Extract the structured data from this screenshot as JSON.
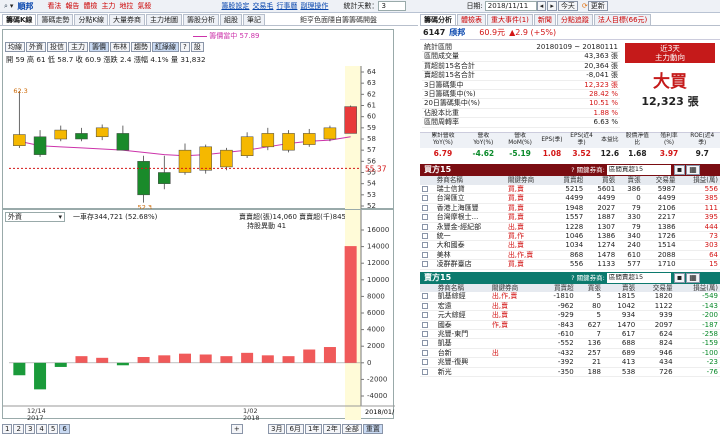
{
  "topbar": {
    "stock": "順邦",
    "links": [
      "看法",
      "報告",
      "體檢",
      "主力",
      "地拉",
      "氣殺"
    ],
    "right_links": [
      "籌股設定",
      "交易毛",
      "行事曆",
      "副理操作"
    ],
    "days_label": "統計天數：",
    "days_value": "3",
    "date_label": "日期:",
    "date_value": "2018/11/11",
    "today": "今天",
    "refresh": "更新"
  },
  "left": {
    "tabs": [
      "籌碼K線",
      "籌碼走勢",
      "分點K線",
      "大量券商",
      "主力地圖",
      "籌股分析",
      "組股",
      "筆記"
    ],
    "tab_active": 0,
    "tab_note": "鉅亨色面隱自籌籌碼開盤",
    "legend_line": "籌價當中 57.89",
    "tools": [
      "均線",
      "外資",
      "投信",
      "主力",
      "籌價",
      "布林",
      "趨勢",
      "紅綠線",
      "?",
      "設"
    ],
    "tools_on": [
      4,
      7
    ],
    "quote": "開 59 高 61 低 58.7 收 60.9 漲跌 2.4 漲幅 4.1% 量 31,832",
    "price_axis": [
      "64",
      "63",
      "62",
      "61",
      "60",
      "59",
      "58",
      "57",
      "56",
      "55",
      "54",
      "53",
      "52"
    ],
    "price_marker": "55.37",
    "max_label": "62.3",
    "min_label": "52.3",
    "sub_select": "外資",
    "sub_info": "一車存344,721 (52.68%)",
    "sub_info2": "賣賣超(張)14,060 賣賣超(千)845,478",
    "sub_info3": "持股異動 41",
    "vol_axis": [
      "16000",
      "14000",
      "12000",
      "10000",
      "8000",
      "6000",
      "4000",
      "2000",
      "0",
      "-2000",
      "-4000"
    ],
    "date_axis": [
      "12/14",
      "2017",
      "1/02",
      "2018"
    ],
    "date_cursor": "2018/01/11",
    "pages": [
      "1",
      "2",
      "3",
      "4",
      "5",
      "6"
    ],
    "ranges": [
      "3月",
      "6月",
      "1年",
      "2年",
      "全部",
      "重置"
    ]
  },
  "right": {
    "tabs": [
      "籌碼分析",
      "體檢表",
      "重大事件(1)",
      "新聞",
      "分點追蹤",
      "法人目標(66元)"
    ],
    "stock_code": "6147",
    "stock_name": "頎邦",
    "stock_price": "60.9元",
    "stock_change": "▲2.9 (+5%)",
    "stats": [
      {
        "label": "統計區間",
        "value": "20180109 ~ 20180111",
        "cls": ""
      },
      {
        "label": "區間成交量",
        "value": "43,363 張",
        "cls": ""
      },
      {
        "label": "買超前15名合計",
        "value": "20,364 張",
        "cls": ""
      },
      {
        "label": "賣超前15名合計",
        "value": "-8,041 張",
        "cls": ""
      },
      {
        "label": "3日籌碼集中",
        "value": "12,323 張",
        "cls": "rd"
      },
      {
        "label": "3日籌碼集中(%)",
        "value": "28.42 %",
        "cls": "rd"
      },
      {
        "label": "20日籌碼集中(%)",
        "value": "10.51 %",
        "cls": "rd"
      },
      {
        "label": "佔股本比重",
        "value": "1.88 %",
        "cls": "rd"
      },
      {
        "label": "區間周轉率",
        "value": "6.63 %",
        "cls": ""
      }
    ],
    "box_title": "近3天\n主力動向",
    "box_big": "大買",
    "box_value": "12,323 張",
    "fin_headers": [
      "累計營收YoY(%)",
      "營收YoY(%)",
      "營收MoM(%)",
      "EPS(季)",
      "EPS(近4季)",
      "本益比",
      "股價淨值比",
      "殖利率(%)",
      "ROE(近4季)"
    ],
    "fin_values": [
      "6.79",
      "-4.62",
      "-5.19",
      "1.08",
      "3.52",
      "12.6",
      "1.68",
      "3.97",
      "9.7"
    ],
    "fin_cls": [
      "rd",
      "gn",
      "gn",
      "rd",
      "rd",
      "",
      "",
      "rd",
      ""
    ],
    "buy_title": "買方15",
    "buy_filter_label": "? 關鍵券商:",
    "buy_filter": "區間買超15",
    "sell_title": "賣方15",
    "sell_filter_label": "? 關鍵券商:",
    "sell_filter": "區間賣超15",
    "table_headers": [
      "券商名稱",
      "關鍵券商",
      "買賣超",
      "買張",
      "賣張",
      "交易量",
      "損益(萬)"
    ],
    "buy_rows": [
      [
        "瑞士信貸",
        "買,賣",
        "5215",
        "5601",
        "386",
        "5987",
        "556"
      ],
      [
        "台灣匯立",
        "買,賣",
        "4499",
        "4499",
        "0",
        "4499",
        "385"
      ],
      [
        "香港上海匯豐",
        "買,賣",
        "1948",
        "2027",
        "79",
        "2106",
        "111"
      ],
      [
        "台灣摩根士...",
        "買,賣",
        "1557",
        "1887",
        "330",
        "2217",
        "395"
      ],
      [
        "永豐金-經紀部",
        "出,賣",
        "1228",
        "1307",
        "79",
        "1386",
        "444"
      ],
      [
        "統一",
        "買,作",
        "1046",
        "1386",
        "340",
        "1726",
        "73"
      ],
      [
        "大和國泰",
        "出,賣",
        "1034",
        "1274",
        "240",
        "1514",
        "303"
      ],
      [
        "美林",
        "出,作,賣",
        "868",
        "1478",
        "610",
        "2088",
        "64"
      ],
      [
        "凌群群臺店",
        "買,賣",
        "556",
        "1133",
        "577",
        "1710",
        "15"
      ]
    ],
    "sell_rows": [
      [
        "凱基綜經",
        "出,作,賣",
        "-1810",
        "5",
        "1815",
        "1820",
        "-549"
      ],
      [
        "宏遠",
        "出,賣",
        "-962",
        "80",
        "1042",
        "1122",
        "-143"
      ],
      [
        "元大綜經",
        "出,賣",
        "-929",
        "5",
        "934",
        "939",
        "-200"
      ],
      [
        "國泰",
        "作,賣",
        "-843",
        "627",
        "1470",
        "2097",
        "-187"
      ],
      [
        "兆豐-東門",
        "",
        "-610",
        "7",
        "617",
        "624",
        "-258"
      ],
      [
        "凱基",
        "",
        "-552",
        "136",
        "688",
        "824",
        "-159"
      ],
      [
        "台新",
        "出",
        "-432",
        "257",
        "689",
        "946",
        "-100"
      ],
      [
        "兆豐-復興",
        "",
        "-392",
        "21",
        "413",
        "434",
        "-23"
      ],
      [
        "新光",
        "",
        "-350",
        "188",
        "538",
        "726",
        "-76"
      ]
    ]
  },
  "chart_data": [
    {
      "type": "candlestick",
      "title": "",
      "ylim": [
        52,
        64
      ],
      "yticks": [
        52,
        53,
        54,
        55,
        56,
        57,
        58,
        59,
        60,
        61,
        62,
        63,
        64
      ],
      "candles": [
        {
          "o": 57.4,
          "c": 58.4,
          "h": 62.3,
          "l": 57.2
        },
        {
          "o": 58.2,
          "c": 56.6,
          "h": 58.8,
          "l": 56.4
        },
        {
          "o": 58.0,
          "c": 58.8,
          "h": 59.2,
          "l": 57.8
        },
        {
          "o": 58.5,
          "c": 58.0,
          "h": 59.0,
          "l": 57.8
        },
        {
          "o": 58.2,
          "c": 59.0,
          "h": 59.3,
          "l": 57.9
        },
        {
          "o": 58.5,
          "c": 57.0,
          "h": 59.2,
          "l": 57.0
        },
        {
          "o": 56.0,
          "c": 53.0,
          "h": 56.5,
          "l": 52.3
        },
        {
          "o": 55.0,
          "c": 54.0,
          "h": 56.5,
          "l": 53.5
        },
        {
          "o": 55.0,
          "c": 57.0,
          "h": 57.6,
          "l": 54.8
        },
        {
          "o": 55.2,
          "c": 57.3,
          "h": 57.5,
          "l": 54.9
        },
        {
          "o": 55.5,
          "c": 57.0,
          "h": 57.2,
          "l": 55.2
        },
        {
          "o": 56.5,
          "c": 58.2,
          "h": 58.6,
          "l": 56.3
        },
        {
          "o": 57.3,
          "c": 58.5,
          "h": 59.0,
          "l": 57.0
        },
        {
          "o": 57.0,
          "c": 58.5,
          "h": 58.8,
          "l": 56.8
        },
        {
          "o": 57.5,
          "c": 58.5,
          "h": 58.9,
          "l": 57.3
        },
        {
          "o": 58.0,
          "c": 59.0,
          "h": 59.2,
          "l": 57.8
        },
        {
          "o": 58.5,
          "c": 60.9,
          "h": 61.0,
          "l": 58.5
        }
      ],
      "ma": [
        57.8,
        57.4,
        57.3,
        57.2,
        57.1,
        57.0,
        56.8,
        56.6,
        56.5,
        56.6,
        56.8,
        57.0,
        57.3,
        57.6,
        57.8,
        57.9,
        58.2
      ]
    },
    {
      "type": "bar",
      "title": "",
      "ylim": [
        -4000,
        16000
      ],
      "values": [
        -1500,
        -3200,
        -500,
        800,
        600,
        -300,
        700,
        900,
        1100,
        1000,
        800,
        1200,
        900,
        800,
        1600,
        1900,
        14060
      ]
    }
  ]
}
